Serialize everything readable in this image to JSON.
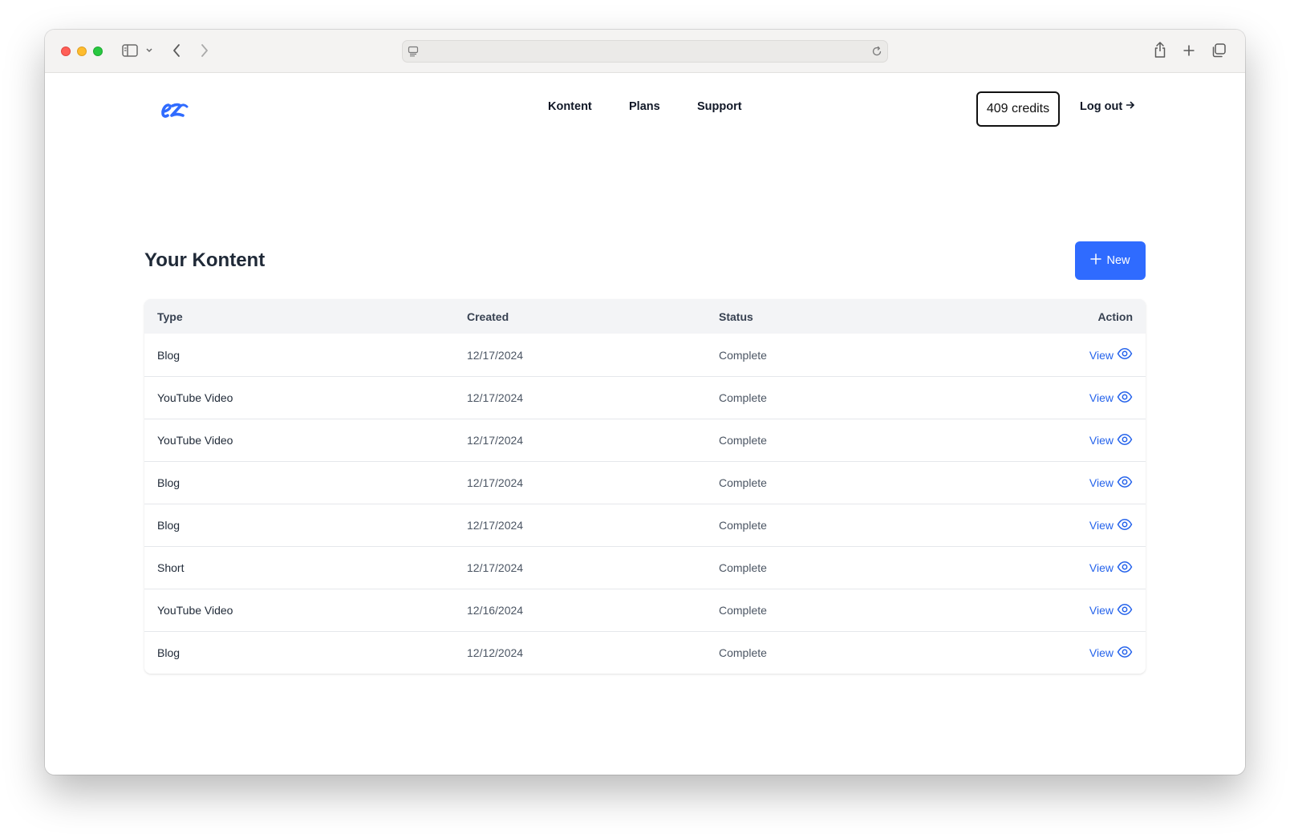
{
  "nav": {
    "items": [
      {
        "label": "Kontent"
      },
      {
        "label": "Plans"
      },
      {
        "label": "Support"
      }
    ]
  },
  "credits": {
    "label": "409 credits"
  },
  "logout": {
    "label": "Log out"
  },
  "page": {
    "title": "Your Kontent",
    "new_button": "New"
  },
  "table": {
    "headers": {
      "type": "Type",
      "created": "Created",
      "status": "Status",
      "action": "Action"
    },
    "action_label": "View",
    "rows": [
      {
        "type": "Blog",
        "created": "12/17/2024",
        "status": "Complete"
      },
      {
        "type": "YouTube Video",
        "created": "12/17/2024",
        "status": "Complete"
      },
      {
        "type": "YouTube Video",
        "created": "12/17/2024",
        "status": "Complete"
      },
      {
        "type": "Blog",
        "created": "12/17/2024",
        "status": "Complete"
      },
      {
        "type": "Blog",
        "created": "12/17/2024",
        "status": "Complete"
      },
      {
        "type": "Short",
        "created": "12/17/2024",
        "status": "Complete"
      },
      {
        "type": "YouTube Video",
        "created": "12/16/2024",
        "status": "Complete"
      },
      {
        "type": "Blog",
        "created": "12/12/2024",
        "status": "Complete"
      }
    ]
  },
  "colors": {
    "brand": "#2f6bff",
    "link": "#2563eb"
  }
}
